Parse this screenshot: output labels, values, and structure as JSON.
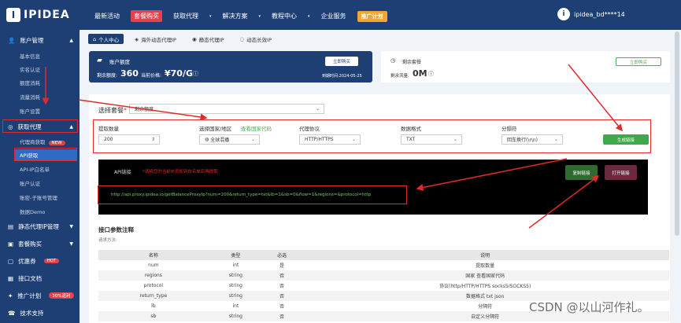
{
  "brand": {
    "logo_letter": "I",
    "name": "IPIDEA"
  },
  "topnav": {
    "items": [
      "最新活动",
      "套餐购买",
      "获取代理",
      "解决方案",
      "教程中心",
      "企业服务"
    ],
    "promo": "推广计划",
    "user": "ipidea_bd****14"
  },
  "sidebar": {
    "groups": [
      {
        "label": "账户管理",
        "items": [
          "基本信息",
          "实名认证",
          "额度消耗",
          "流量消耗",
          "账户设置"
        ]
      },
      {
        "label": "获取代理",
        "items": [
          "代理商获取",
          "API获取",
          "API-IP白名单",
          "账户认证",
          "账密-子账号管理",
          "数据Demo"
        ],
        "badge": "NEW"
      },
      {
        "label": "静态代理IP管理"
      },
      {
        "label": "套餐购买"
      },
      {
        "label": "优惠券",
        "badge": "HOT"
      },
      {
        "label": "接口文档"
      },
      {
        "label": "推广计划",
        "badge": "30%返利"
      },
      {
        "label": "技术支持"
      }
    ]
  },
  "tabs": [
    "个人中心",
    "海外动态代理IP",
    "静态代理IP",
    "动态长效IP"
  ],
  "balance": {
    "title": "账户额度",
    "remaining_label": "剩余额度:",
    "remaining": "360",
    "price_label": "当前价格:",
    "price": "¥70/G",
    "expire": "到期时间:2024-05-25",
    "button": "立即购买"
  },
  "traffic": {
    "title": "剩余套餐",
    "remaining_label": "剩余流量:",
    "remaining": "0M",
    "button": "立即购买"
  },
  "form": {
    "package_label": "选择套餐",
    "package_value": "剩余额度",
    "qty_label": "提取数量",
    "qty_value": "200",
    "region_label": "选择国家/地区",
    "region_link": "查看国家代码",
    "region_value": "全球混播",
    "protocol_label": "代理协议",
    "protocol_value": "HTTP/HTTPS",
    "format_label": "数据格式",
    "format_value": "TXT",
    "sep_label": "分隔符",
    "sep_value": "回车换行(\\r\\n)",
    "generate": "生成链接"
  },
  "api": {
    "label": "API链接",
    "warning": "*请将您的当前IP添加到白名单后再提取",
    "url": "http://api.proxy.ipidea.io/getBalanceProxyIp?num=200&return_type=txt&lb=1&sb=0&flow=1&regions=&protocol=http",
    "copy": "复制链接",
    "open": "打开链接"
  },
  "params": {
    "title": "接口参数注释",
    "subtitle": "请求方法:",
    "headers": [
      "名称",
      "类型",
      "必选",
      "说明"
    ],
    "rows": [
      [
        "num",
        "int",
        "是",
        "提取数量"
      ],
      [
        "regions",
        "string",
        "否",
        "国家  查看国家代码"
      ],
      [
        "protocol",
        "string",
        "否",
        "协议(http/HTTP/HTTPS socks5/SOCKS5)"
      ],
      [
        "return_type",
        "string",
        "否",
        "数据格式 txt json"
      ],
      [
        "lb",
        "int",
        "否",
        "分隔符"
      ],
      [
        "sb",
        "string",
        "否",
        "自定义分隔符"
      ]
    ]
  },
  "watermark": "CSDN @以山河作礼。",
  "colors": {
    "navy": "#1e3f74",
    "green": "#4caf50",
    "red": "#e02b2b"
  }
}
